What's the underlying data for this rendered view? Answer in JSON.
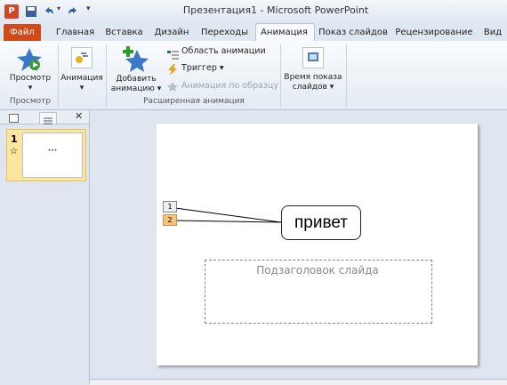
{
  "titlebar": {
    "title": "Презентация1  -  Microsoft PowerPoint",
    "qat_icons": [
      "powerpoint-icon",
      "save-icon",
      "undo-icon",
      "redo-icon",
      "customize-icon"
    ]
  },
  "tabs": {
    "file": "Файл",
    "items": [
      "Главная",
      "Вставка",
      "Дизайн",
      "Переходы",
      "Анимация",
      "Показ слайдов",
      "Рецензирование",
      "Вид"
    ],
    "active": "Анимация"
  },
  "ribbon": {
    "preview": {
      "label": "Просмотр",
      "group": "Просмотр"
    },
    "animation": {
      "label": "Анимация"
    },
    "add_animation": {
      "label_line1": "Добавить",
      "label_line2": "анимацию ▾"
    },
    "animation_pane": "Область анимации",
    "trigger": "Триггер ▾",
    "anim_painter": "Анимация по образцу",
    "advanced_group": "Расширенная анимация",
    "timing": {
      "label_line1": "Время показа",
      "label_line2": "слайдов ▾"
    }
  },
  "slides_panel": {
    "slide_number": "1",
    "star_icon": "☆",
    "thumb_text": "•••"
  },
  "slide": {
    "callout_text": "привет",
    "subtitle_placeholder": "Подзаголовок слайда",
    "anim_badges": [
      "1",
      "2"
    ]
  }
}
